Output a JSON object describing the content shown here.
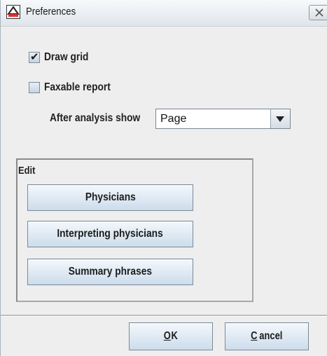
{
  "window": {
    "title": "Preferences",
    "icon": "app-logo-icon",
    "close_icon": "close-icon"
  },
  "options": {
    "draw_grid": {
      "label": "Draw grid",
      "checked": true
    },
    "faxable_report": {
      "label": "Faxable report",
      "checked": false
    },
    "after_analysis": {
      "label": "After analysis show",
      "value": "Page"
    }
  },
  "edit_group": {
    "title": "Edit",
    "buttons": [
      "Physicians",
      "Interpreting physicians",
      "Summary phrases"
    ]
  },
  "footer": {
    "ok": {
      "mnemonic": "O",
      "rest": "K"
    },
    "cancel": {
      "mnemonic": "C",
      "rest": "ancel"
    }
  },
  "colors": {
    "dialog_bg": "#eeeeee",
    "button_gradient_top": "#f4f8fc",
    "button_gradient_bottom": "#ccdcec",
    "border": "#7b8a99"
  }
}
